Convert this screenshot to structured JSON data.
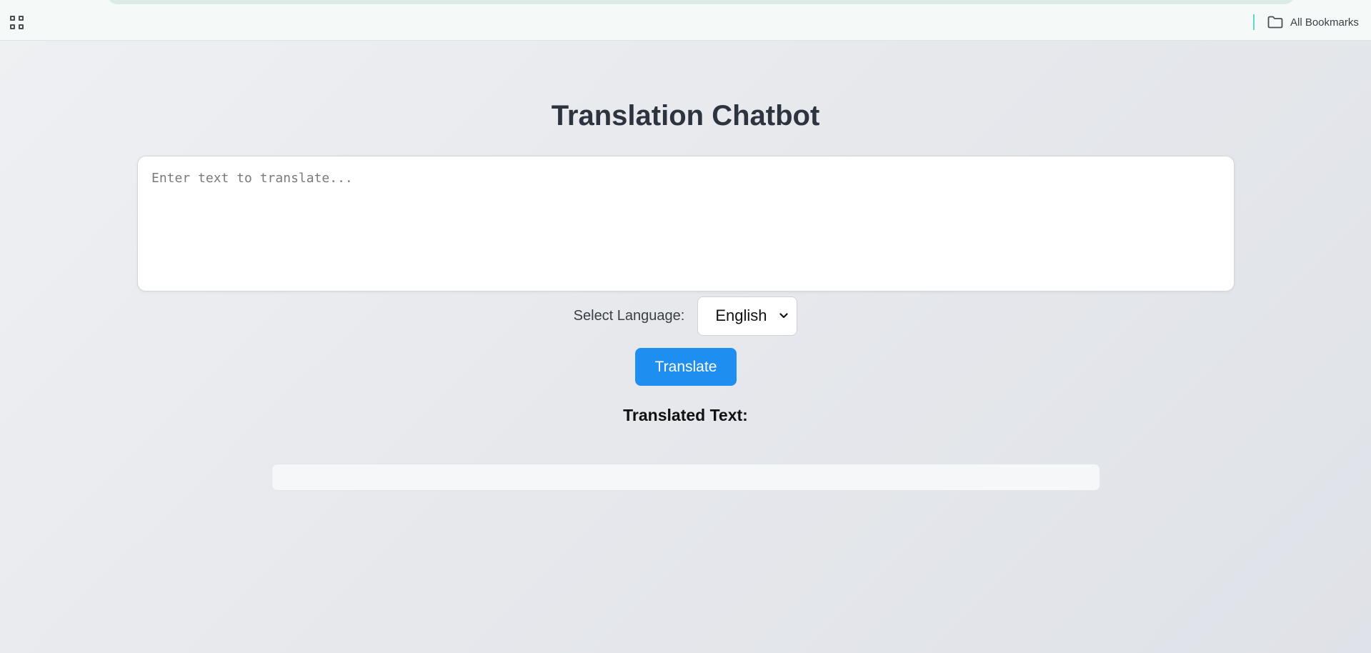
{
  "browser": {
    "bookmarks_label": "All Bookmarks"
  },
  "page": {
    "title": "Translation Chatbot",
    "input": {
      "placeholder": "Enter text to translate...",
      "value": ""
    },
    "language": {
      "label": "Select Language:",
      "selected": "English"
    },
    "translate_button": "Translate",
    "result": {
      "heading": "Translated Text:",
      "text": ""
    }
  },
  "colors": {
    "primary_button": "#1f8ef1",
    "title_text": "#2d3440"
  },
  "icons": {
    "apps": "apps-grid-icon",
    "bookmarks": "folder-icon",
    "select": "chevron-down-icon"
  }
}
